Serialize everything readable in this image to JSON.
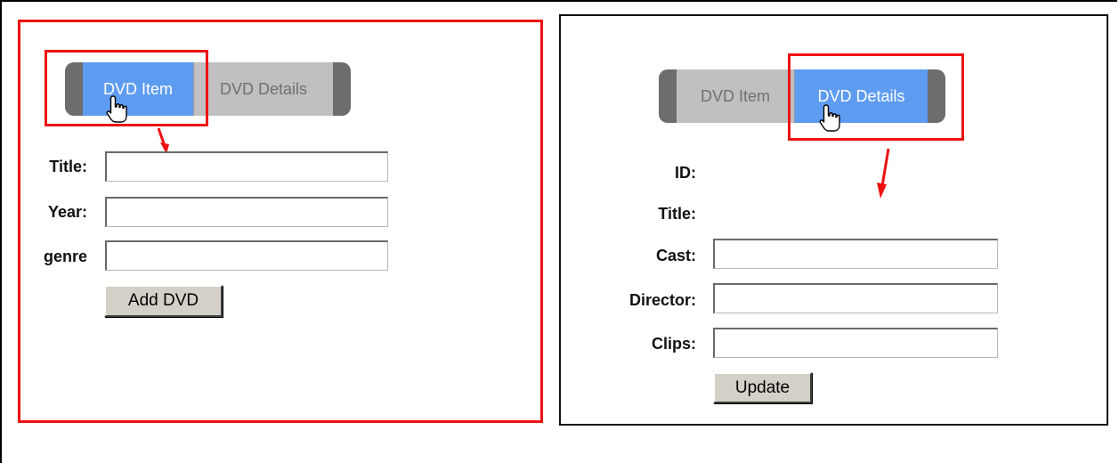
{
  "left_panel": {
    "tabs": [
      {
        "label": "DVD Item",
        "active": true
      },
      {
        "label": "DVD Details",
        "active": false
      }
    ],
    "fields": [
      {
        "label": "Title:",
        "value": ""
      },
      {
        "label": "Year:",
        "value": ""
      },
      {
        "label": "genre",
        "value": ""
      }
    ],
    "button_label": "Add DVD"
  },
  "right_panel": {
    "tabs": [
      {
        "label": "DVD Item",
        "active": false
      },
      {
        "label": "DVD Details",
        "active": true
      }
    ],
    "static_fields": [
      {
        "label": "ID:",
        "value": ""
      },
      {
        "label": "Title:",
        "value": ""
      }
    ],
    "fields": [
      {
        "label": "Cast:",
        "value": ""
      },
      {
        "label": "Director:",
        "value": ""
      },
      {
        "label": "Clips:",
        "value": ""
      }
    ],
    "button_label": "Update"
  },
  "colors": {
    "annotation_red": "#ee1111",
    "active_tab_blue": "#5e9cf2",
    "tab_gray": "#c0c0c0",
    "tab_cap_gray": "#6d6d6d",
    "button_face": "#d4d0c8"
  },
  "icons": {
    "cursor": "hand-pointer-icon",
    "annotation": "red-arrow-icon"
  }
}
